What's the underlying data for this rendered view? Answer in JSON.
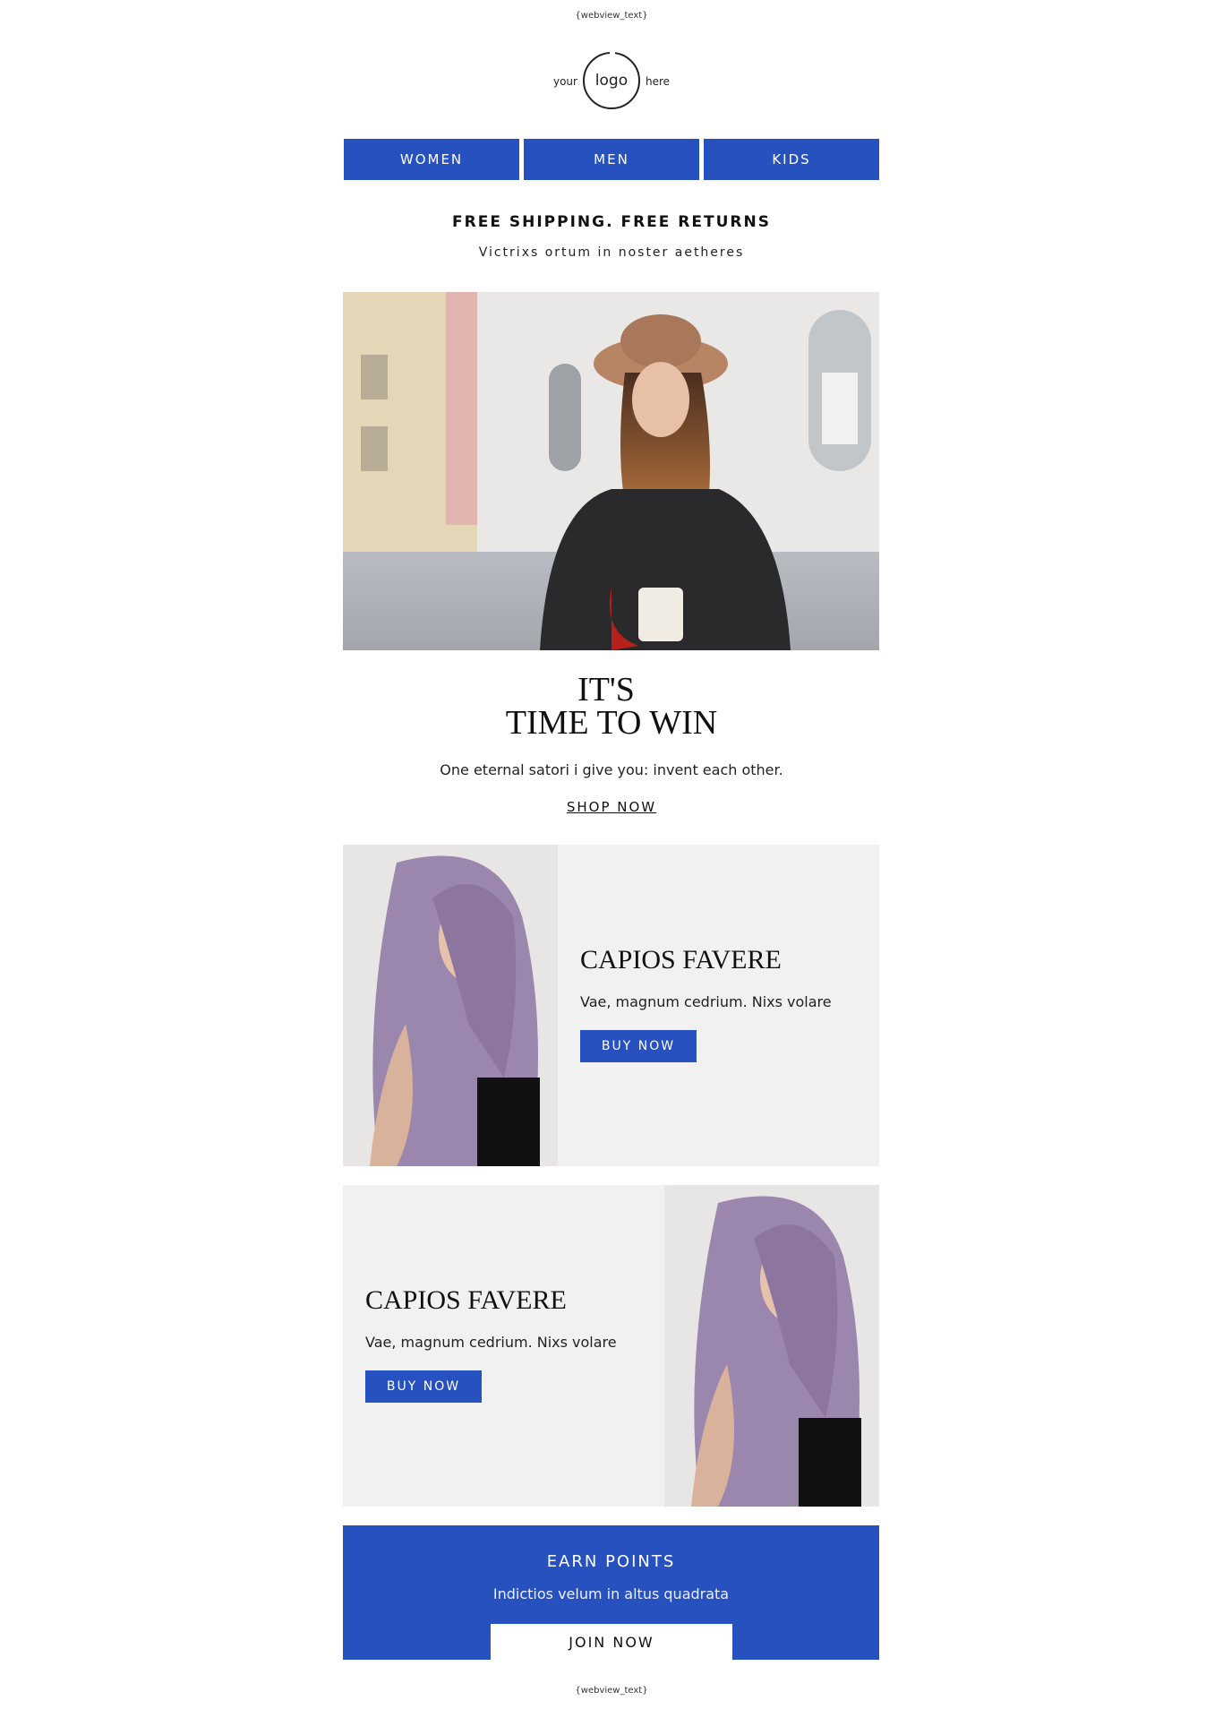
{
  "webview_top": "{webview_text}",
  "webview_bottom": "{webview_text}",
  "logo": {
    "left": "your",
    "center": "logo",
    "right": "here"
  },
  "nav": {
    "items": [
      "WOMEN",
      "MEN",
      "KIDS"
    ]
  },
  "shipping": {
    "title": "FREE SHIPPING. FREE RETURNS",
    "subtitle": "Victrixs ortum in noster aetheres"
  },
  "hero": {
    "image": "woman-in-hat-city-street-photo"
  },
  "headline": {
    "line1": "IT'S",
    "line2": "TIME TO WIN",
    "tagline": "One eternal satori i give you: invent each other.",
    "cta": "SHOP NOW"
  },
  "products": [
    {
      "title": "CAPIOS FAVERE",
      "description": "Vae, magnum cedrium. Nixs volare",
      "button": "BUY NOW",
      "image": "woman-lilac-hair-photo"
    },
    {
      "title": "CAPIOS FAVERE",
      "description": "Vae, magnum cedrium. Nixs volare",
      "button": "BUY NOW",
      "image": "woman-lilac-hair-photo"
    }
  ],
  "earn": {
    "title": "EARN POINTS",
    "subtitle": "Indictios velum in altus quadrata",
    "button": "JOIN NOW"
  },
  "colors": {
    "accent": "#2751be",
    "panel": "#f1f1f1",
    "text": "#111111"
  }
}
